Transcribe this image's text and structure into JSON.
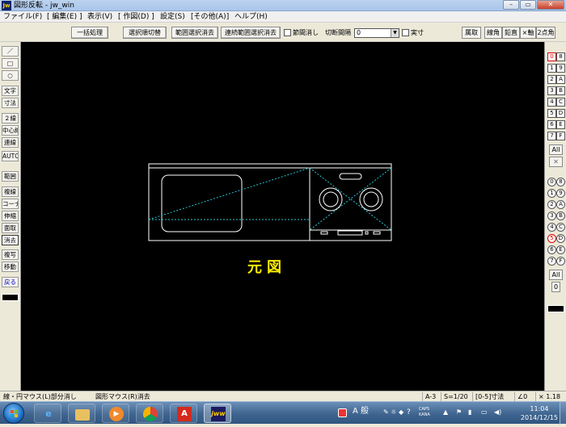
{
  "window": {
    "title": "図形反転 - jw_win",
    "app_icon": "Jw",
    "min": "–",
    "max": "▭",
    "close": "✕"
  },
  "menu": [
    "ファイル(F)",
    "[ 編集(E) ]",
    "表示(V)",
    "[ 作図(D) ]",
    "設定(S)",
    "[その他(A)]",
    "ヘルプ(H)"
  ],
  "toolbar": {
    "batch": "一括処理",
    "select_order": "選択順切替",
    "range_delete": "範囲選択消去",
    "continuous_delete": "連続範囲選択消去",
    "node_erase_label": "節間消し",
    "cut_interval_label": "切断間隔",
    "cut_interval_value": "0",
    "actual_size_label": "実寸",
    "right": [
      "属取",
      "線角",
      "鉛直",
      "×軸",
      "2点角"
    ]
  },
  "left_tools": [
    "／",
    "□",
    "○",
    "文字",
    "寸法",
    "２線",
    "中心線",
    "連線",
    "AUTO",
    "範囲",
    "複線",
    "コーナー",
    "伸縮",
    "面取",
    "消去",
    "複写",
    "移動",
    "戻る"
  ],
  "right_layers": {
    "group1": [
      [
        "0",
        "8"
      ],
      [
        "1",
        "9"
      ],
      [
        "2",
        "A"
      ],
      [
        "3",
        "B"
      ],
      [
        "4",
        "C"
      ],
      [
        "5",
        "D"
      ],
      [
        "6",
        "E"
      ],
      [
        "7",
        "F"
      ]
    ],
    "all1": "All",
    "x_btn": "✕",
    "group2": [
      [
        "0",
        "8"
      ],
      [
        "1",
        "9"
      ],
      [
        "2",
        "A"
      ],
      [
        "3",
        "B"
      ],
      [
        "4",
        "C"
      ],
      [
        "5",
        "D"
      ],
      [
        "6",
        "E"
      ],
      [
        "7",
        "F"
      ]
    ],
    "all2": "All",
    "zero": "0"
  },
  "drawing": {
    "label": "元図",
    "label_color": "#ffee00",
    "line_color": "#ffffff",
    "aux_color": "#29c6d8"
  },
  "status": {
    "left_hint": "線・円マウス(L)部分消し",
    "right_hint": "図形マウス(R)消去",
    "paper": "A-3",
    "scale": "S=1/20",
    "layer": "[0-5]寸法",
    "angle": "∠0",
    "zoom": "× 1.18"
  },
  "taskbar": {
    "ime": "A 般",
    "clock_time": "11:04",
    "clock_date": "2014/12/15",
    "caps": "CAPS",
    "kana": "KANA"
  }
}
